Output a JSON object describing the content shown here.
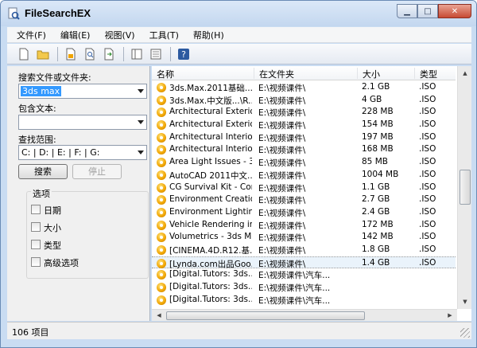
{
  "window": {
    "title": "FileSearchEX"
  },
  "menu": [
    "文件(F)",
    "编辑(E)",
    "视图(V)",
    "工具(T)",
    "帮助(H)"
  ],
  "toolbar": {
    "icons": [
      "new-file-icon",
      "open-folder-icon",
      "document-icon",
      "find-document-icon",
      "export-document-icon",
      "panel-view-icon",
      "list-view-icon",
      "help-icon"
    ]
  },
  "left": {
    "search_label": "搜索文件或文件夹:",
    "search_value": "3ds max",
    "contains_label": "包含文本:",
    "contains_value": "",
    "scope_label": "查找范围:",
    "scope_value": "C: | D: | E: | F: | G:",
    "search_button": "搜索",
    "stop_button": "停止",
    "options_title": "选项",
    "options": [
      "日期",
      "大小",
      "类型",
      "高级选项"
    ]
  },
  "grid": {
    "columns": [
      "名称",
      "在文件夹",
      "大小",
      "类型"
    ],
    "rows": [
      {
        "name": "3ds.Max.2011基础...",
        "folder": "E:\\视频课件\\",
        "size": "2.1 GB",
        "type": ".ISO"
      },
      {
        "name": "3ds.Max.中文版...\\R...",
        "folder": "E:\\视频课件\\",
        "size": "4 GB",
        "type": ".ISO"
      },
      {
        "name": "Architectural Exterior...",
        "folder": "E:\\视频课件\\",
        "size": "228 MB",
        "type": ".ISO"
      },
      {
        "name": "Architectural Exterior...",
        "folder": "E:\\视频课件\\",
        "size": "154 MB",
        "type": ".ISO"
      },
      {
        "name": "Architectural Interior...",
        "folder": "E:\\视频课件\\",
        "size": "197 MB",
        "type": ".ISO"
      },
      {
        "name": "Architectural Interior...",
        "folder": "E:\\视频课件\\",
        "size": "168 MB",
        "type": ".ISO"
      },
      {
        "name": "Area Light Issues - 3...",
        "folder": "E:\\视频课件\\",
        "size": "85 MB",
        "type": ".ISO"
      },
      {
        "name": "AutoCAD 2011中文...",
        "folder": "E:\\视频课件\\",
        "size": "1004 MB",
        "type": ".ISO"
      },
      {
        "name": "CG Survival Kit - Con...",
        "folder": "E:\\视频课件\\",
        "size": "1.1 GB",
        "type": ".ISO"
      },
      {
        "name": "Environment Creatio...",
        "folder": "E:\\视频课件\\",
        "size": "2.7 GB",
        "type": ".ISO"
      },
      {
        "name": "Environment Lighting...",
        "folder": "E:\\视频课件\\",
        "size": "2.4 GB",
        "type": ".ISO"
      },
      {
        "name": "Vehicle Rendering in ...",
        "folder": "E:\\视频课件\\",
        "size": "172 MB",
        "type": ".ISO"
      },
      {
        "name": "Volumetrics - 3ds Ma...",
        "folder": "E:\\视频课件\\",
        "size": "142 MB",
        "type": ".ISO"
      },
      {
        "name": "[CINEMA.4D.R12.基...",
        "folder": "E:\\视频课件\\",
        "size": "1.8 GB",
        "type": ".ISO"
      },
      {
        "name": "[Lynda.com出品Goo...",
        "folder": "E:\\视频课件\\",
        "size": "1.4 GB",
        "type": ".ISO"
      },
      {
        "name": "[Digital.Tutors: 3ds....",
        "folder": "E:\\视频课件\\汽车...",
        "size": "",
        "type": ""
      },
      {
        "name": "[Digital.Tutors: 3ds....",
        "folder": "E:\\视频课件\\汽车...",
        "size": "",
        "type": ""
      },
      {
        "name": "[Digital.Tutors: 3ds....",
        "folder": "E:\\视频课件\\汽车...",
        "size": "",
        "type": ""
      }
    ],
    "selected_row": 14
  },
  "status": {
    "text": "106 项目"
  }
}
